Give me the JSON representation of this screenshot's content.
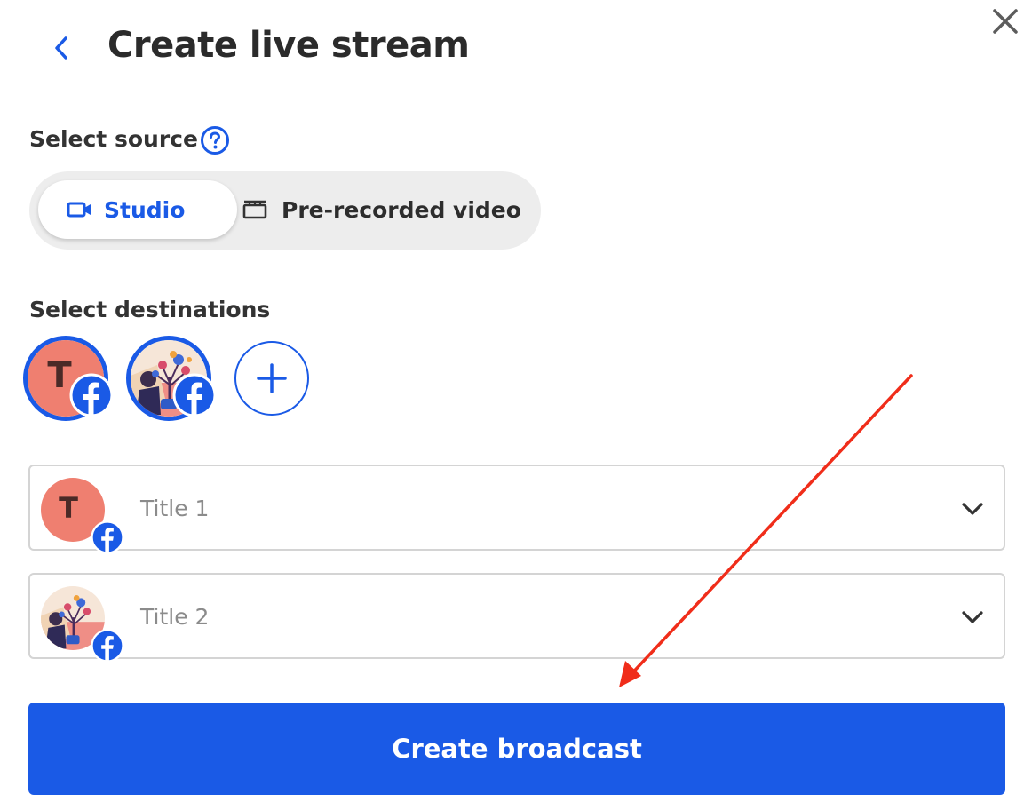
{
  "header": {
    "title": "Create live stream",
    "back_icon": "chevron-left-icon",
    "close_icon": "close-icon"
  },
  "source": {
    "label": "Select source",
    "help_icon": "question-circle-icon",
    "options": [
      {
        "label": "Studio",
        "icon": "video-camera-icon",
        "selected": true
      },
      {
        "label": "Pre-recorded video",
        "icon": "film-icon",
        "selected": false
      }
    ]
  },
  "destinations": {
    "label": "Select destinations",
    "avatars": [
      {
        "letter": "T",
        "platform_icon": "facebook-icon"
      },
      {
        "image": "illustration",
        "platform_icon": "facebook-icon"
      }
    ],
    "add_icon": "plus-icon"
  },
  "titles": [
    {
      "placeholder": "Title 1",
      "avatar_letter": "T"
    },
    {
      "placeholder": "Title 2"
    }
  ],
  "actions": {
    "create_label": "Create broadcast"
  },
  "colors": {
    "accent": "#1a5ae6",
    "toggle_bg": "#ededed",
    "avatar_t_bg": "#ef7f70",
    "annotation_arrow": "#f02d1a"
  }
}
